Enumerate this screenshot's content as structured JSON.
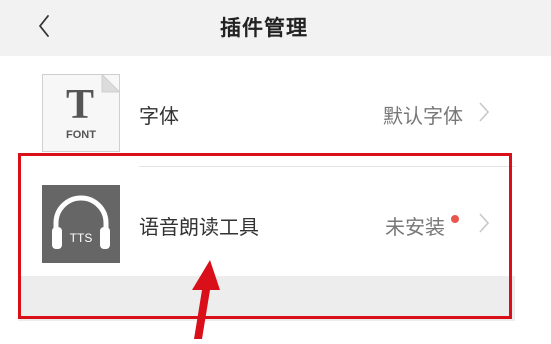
{
  "header": {
    "title": "插件管理"
  },
  "plugins": [
    {
      "icon": "font-icon",
      "icon_text": "FONT",
      "label": "字体",
      "value": "默认字体"
    },
    {
      "icon": "headphones-tts-icon",
      "icon_text": "TTS",
      "label": "语音朗读工具",
      "value": "未安装",
      "has_badge": true
    }
  ],
  "colors": {
    "accent_red": "#d9101a",
    "badge_red": "#e8554e",
    "header_bg": "#f2f2f2"
  }
}
